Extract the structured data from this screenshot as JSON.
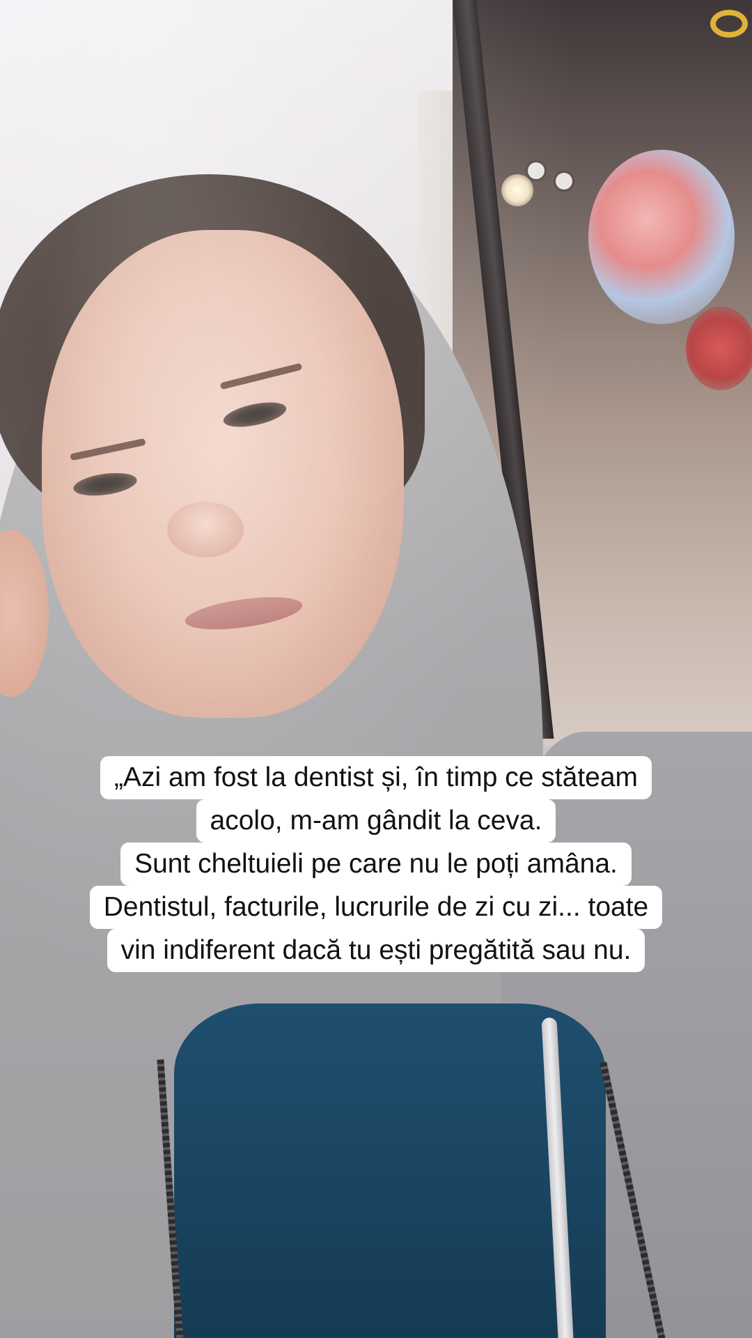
{
  "caption": {
    "lines": [
      "„Azi am fost la dentist și, în timp ce stăteam",
      "acolo, m-am gândit la ceva.",
      "Sunt cheltuieli pe care nu le poți amâna.",
      "Dentistul, facturile, lucrurile de zi cu zi... toate",
      "vin indiferent dacă tu ești pregătită sau nu."
    ],
    "background_color": "#ffffff",
    "text_color": "#111111"
  }
}
